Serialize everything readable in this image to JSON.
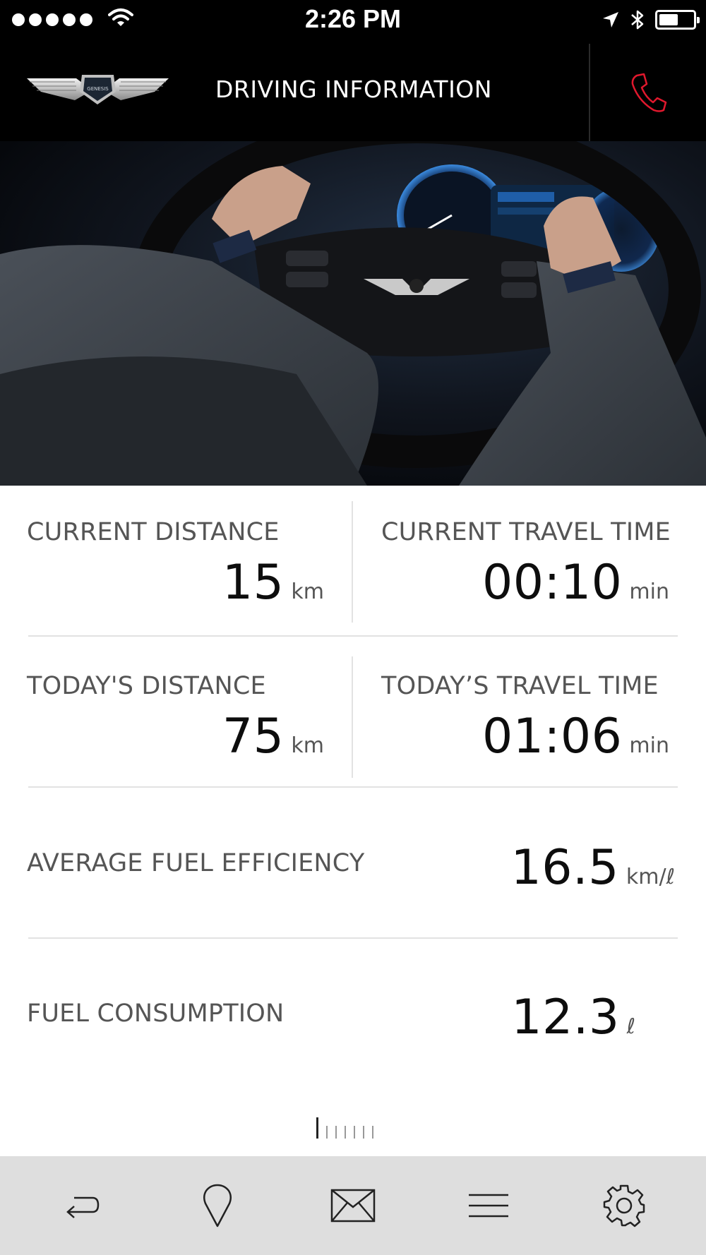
{
  "status_bar": {
    "time": "2:26 PM"
  },
  "header": {
    "title": "DRIVING INFORMATION",
    "logo_text": "GENESIS",
    "call_icon": "phone-icon",
    "call_icon_color": "#e0182d"
  },
  "stats": {
    "current_distance": {
      "label": "CURRENT DISTANCE",
      "value": "15",
      "unit": "km"
    },
    "current_travel_time": {
      "label": "CURRENT TRAVEL TIME",
      "value": "00:10",
      "unit": "min"
    },
    "todays_distance": {
      "label": "TODAY'S DISTANCE",
      "value": "75",
      "unit": "km"
    },
    "todays_travel_time": {
      "label": "TODAY’S TRAVEL TIME",
      "value": "01:06",
      "unit": "min"
    },
    "avg_fuel_efficiency": {
      "label": "AVERAGE FUEL EFFICIENCY",
      "value": "16.5",
      "unit": "km/ℓ"
    },
    "fuel_consumption": {
      "label": "FUEL CONSUMPTION",
      "value": "12.3",
      "unit": "ℓ"
    }
  },
  "pager": {
    "pages": 7,
    "active_index": 0
  },
  "tabbar": {
    "items": [
      {
        "icon": "back-arrow-icon"
      },
      {
        "icon": "map-pin-icon"
      },
      {
        "icon": "mail-icon"
      },
      {
        "icon": "menu-icon"
      },
      {
        "icon": "gear-icon"
      }
    ]
  }
}
